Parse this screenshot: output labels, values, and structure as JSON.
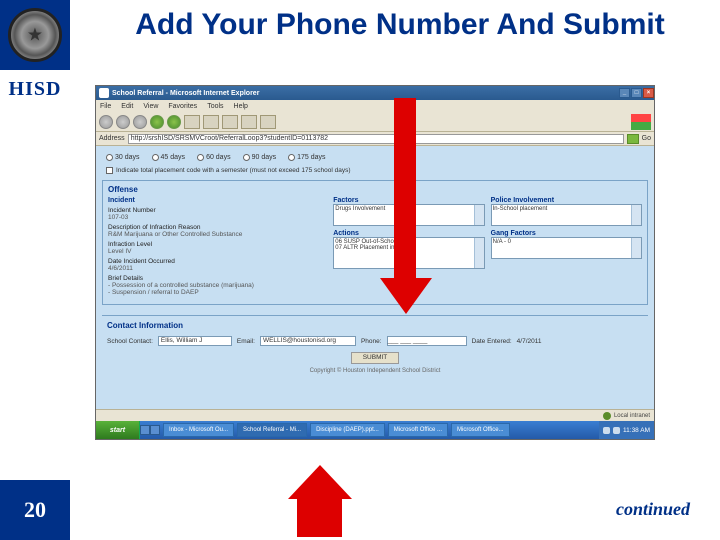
{
  "slide": {
    "title": "Add Your Phone Number And Submit",
    "hisd": "HISD",
    "page_number": "20",
    "continued": "continued"
  },
  "ie": {
    "window_title": "School Referral - Microsoft Internet Explorer",
    "menu": {
      "file": "File",
      "edit": "Edit",
      "view": "View",
      "favorites": "Favorites",
      "tools": "Tools",
      "help": "Help"
    },
    "address_label": "Address",
    "address_value": "http://srshISD/SRSMVCroot/ReferralLoop3?studentID=0113782",
    "go": "Go",
    "status_zone": "Local intranet"
  },
  "form": {
    "days": {
      "d30": "30 days",
      "d45": "45 days",
      "d60": "60 days",
      "d90": "90 days",
      "d175": "175 days"
    },
    "extend_label": "Indicate total placement code with a semester (must not exceed 175 school days)",
    "offense_title": "Offense",
    "incident_label": "Incident",
    "incident_num_label": "Incident Number",
    "incident_num": "107-03",
    "desc_label": "Description of Infraction Reason",
    "desc_value": "R&M Marijuana or Other Controlled Substance",
    "level_label": "Infraction Level",
    "level_value": "Level IV",
    "date_label": "Date Incident Occurred",
    "date_value": "4/6/2011",
    "brief_label": "Brief Details",
    "brief_value": "- Possession of a controlled substance (marijuana)\n- Suspension / referral to DAEP",
    "factors_title": "Factors",
    "factors_item": "Drugs Involvement",
    "actions_title": "Actions",
    "actions_item1": "06 SUSP Out-of-School Susp",
    "actions_item2": "07 ALTR Placement in DAEP",
    "police_title": "Police Involvement",
    "police_item": "In-School placement",
    "gang_title": "Gang Factors",
    "gang_item": "N/A - 0"
  },
  "contact": {
    "title": "Contact Information",
    "school_contact_label": "School Contact:",
    "school_contact_value": "Ellis, William J",
    "email_label": "Email:",
    "email_value": "WELLIS@houstonisd.org",
    "phone_label": "Phone:",
    "phone_value": "___ ___ ____",
    "date_entered_label": "Date Entered:",
    "date_entered_value": "4/7/2011",
    "submit": "SUBMIT",
    "copyright": "Copyright © Houston Independent School District"
  },
  "taskbar": {
    "start": "start",
    "items": [
      "Inbox - Microsoft Ou...",
      "School Referral - Mi...",
      "Discipline (DAEP).ppt...",
      "Microsoft Office ...",
      "Microsoft Office..."
    ],
    "time": "11:38 AM"
  }
}
